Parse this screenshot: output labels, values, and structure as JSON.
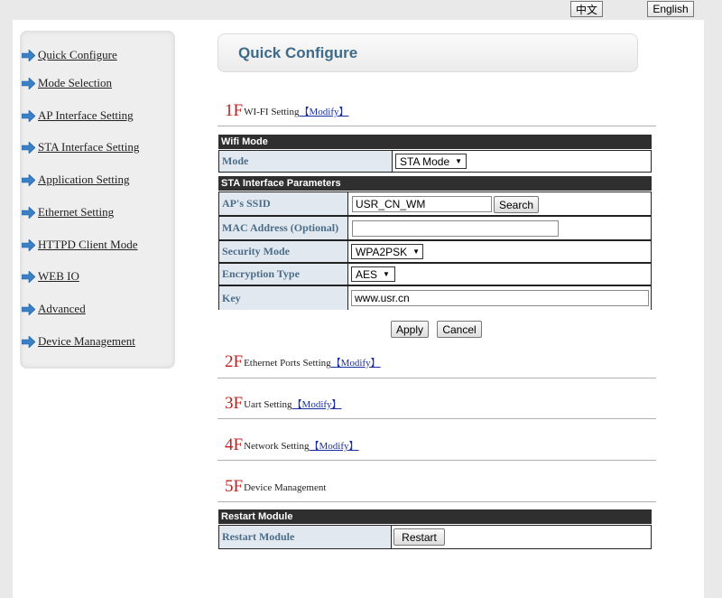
{
  "language": {
    "cn_label": "中文",
    "en_label": "English"
  },
  "sidebar": {
    "items": [
      {
        "label": "Quick Configure"
      },
      {
        "label": "Mode Selection"
      },
      {
        "label": "AP Interface Setting"
      },
      {
        "label": "STA Interface Setting"
      },
      {
        "label": "Application Setting"
      },
      {
        "label": "Ethernet Setting"
      },
      {
        "label": "HTTPD Client Mode"
      },
      {
        "label": "WEB IO"
      },
      {
        "label": "Advanced"
      },
      {
        "label": "Device Management"
      }
    ]
  },
  "header": {
    "title": "Quick Configure"
  },
  "sections": [
    {
      "num": "1F",
      "label": "WI-FI Setting",
      "link": "【Modify】"
    },
    {
      "num": "2F",
      "label": "Ethernet Ports Setting",
      "link": "【Modify】"
    },
    {
      "num": "3F",
      "label": "Uart Setting",
      "link": "【Modify】"
    },
    {
      "num": "4F",
      "label": "Network Setting",
      "link": "【Modify】"
    },
    {
      "num": "5F",
      "label": "Device Management",
      "link": ""
    }
  ],
  "wifi": {
    "band_mode": "Wifi Mode",
    "mode_label": "Mode",
    "mode_value": "STA Mode",
    "band_sta": "STA Interface Parameters",
    "ssid_label": "AP's SSID",
    "ssid_value": "USR_CN_WM",
    "search_label": "Search",
    "mac_label": "MAC Address (Optional)",
    "mac_value": "",
    "security_label": "Security Mode",
    "security_value": "WPA2PSK",
    "encryption_label": "Encryption Type",
    "encryption_value": "AES",
    "key_label": "Key",
    "key_value": "www.usr.cn",
    "apply_label": "Apply",
    "cancel_label": "Cancel"
  },
  "restart": {
    "band": "Restart Module",
    "label": "Restart Module",
    "button_label": "Restart"
  },
  "colors": {
    "accent_title": "#3e6b8a",
    "section_number": "#c0201e",
    "link": "#1a2fa0",
    "band": "#2f2f2f",
    "arrow": "#3b7fc4"
  }
}
